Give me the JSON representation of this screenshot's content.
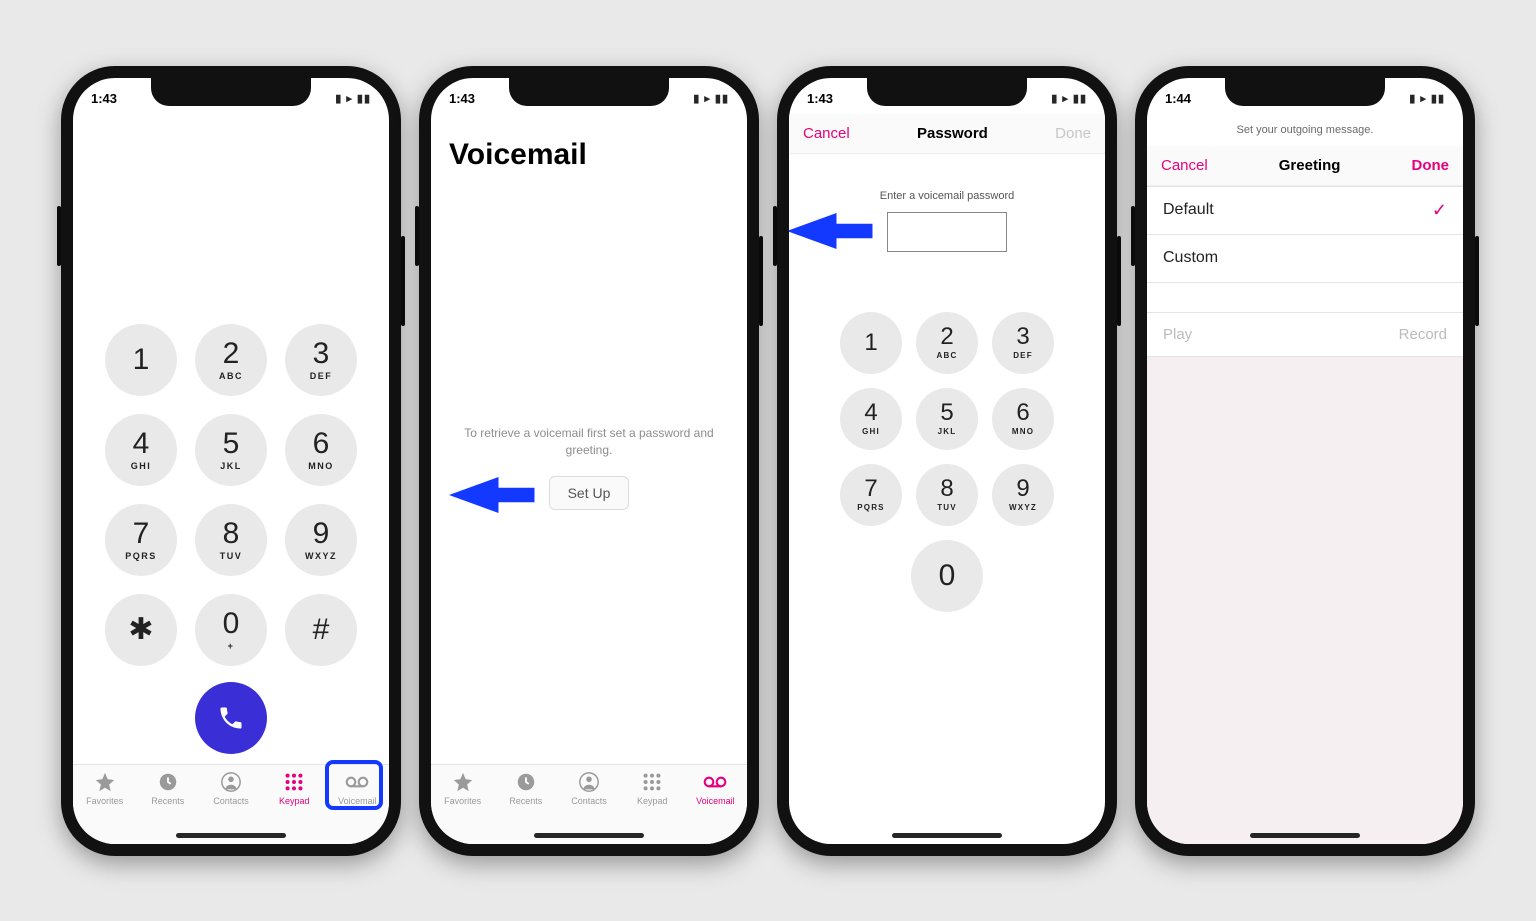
{
  "phones": {
    "s1": {
      "time": "1:43",
      "tabbar": [
        "Favorites",
        "Recents",
        "Contacts",
        "Keypad",
        "Voicemail"
      ],
      "active_tab": "Keypad",
      "keypad": [
        {
          "d": "1",
          "s": ""
        },
        {
          "d": "2",
          "s": "ABC"
        },
        {
          "d": "3",
          "s": "DEF"
        },
        {
          "d": "4",
          "s": "GHI"
        },
        {
          "d": "5",
          "s": "JKL"
        },
        {
          "d": "6",
          "s": "MNO"
        },
        {
          "d": "7",
          "s": "PQRS"
        },
        {
          "d": "8",
          "s": "TUV"
        },
        {
          "d": "9",
          "s": "WXYZ"
        },
        {
          "d": "✱",
          "s": ""
        },
        {
          "d": "0",
          "s": "+"
        },
        {
          "d": "#",
          "s": ""
        }
      ]
    },
    "s2": {
      "time": "1:43",
      "title": "Voicemail",
      "hint": "To retrieve a voicemail first set a password and greeting.",
      "button": "Set Up",
      "tabbar": [
        "Favorites",
        "Recents",
        "Contacts",
        "Keypad",
        "Voicemail"
      ],
      "active_tab": "Voicemail"
    },
    "s3": {
      "time": "1:43",
      "nav": {
        "left": "Cancel",
        "title": "Password",
        "right": "Done"
      },
      "label": "Enter a voicemail password",
      "keypad": [
        {
          "d": "1",
          "s": ""
        },
        {
          "d": "2",
          "s": "ABC"
        },
        {
          "d": "3",
          "s": "DEF"
        },
        {
          "d": "4",
          "s": "GHI"
        },
        {
          "d": "5",
          "s": "JKL"
        },
        {
          "d": "6",
          "s": "MNO"
        },
        {
          "d": "7",
          "s": "PQRS"
        },
        {
          "d": "8",
          "s": "TUV"
        },
        {
          "d": "9",
          "s": "WXYZ"
        }
      ],
      "zero": {
        "d": "0",
        "s": ""
      }
    },
    "s4": {
      "time": "1:44",
      "subhint": "Set your outgoing message.",
      "nav": {
        "left": "Cancel",
        "title": "Greeting",
        "right": "Done"
      },
      "rows": [
        "Default",
        "Custom"
      ],
      "selected": "Default",
      "actions": {
        "left": "Play",
        "right": "Record"
      }
    }
  }
}
